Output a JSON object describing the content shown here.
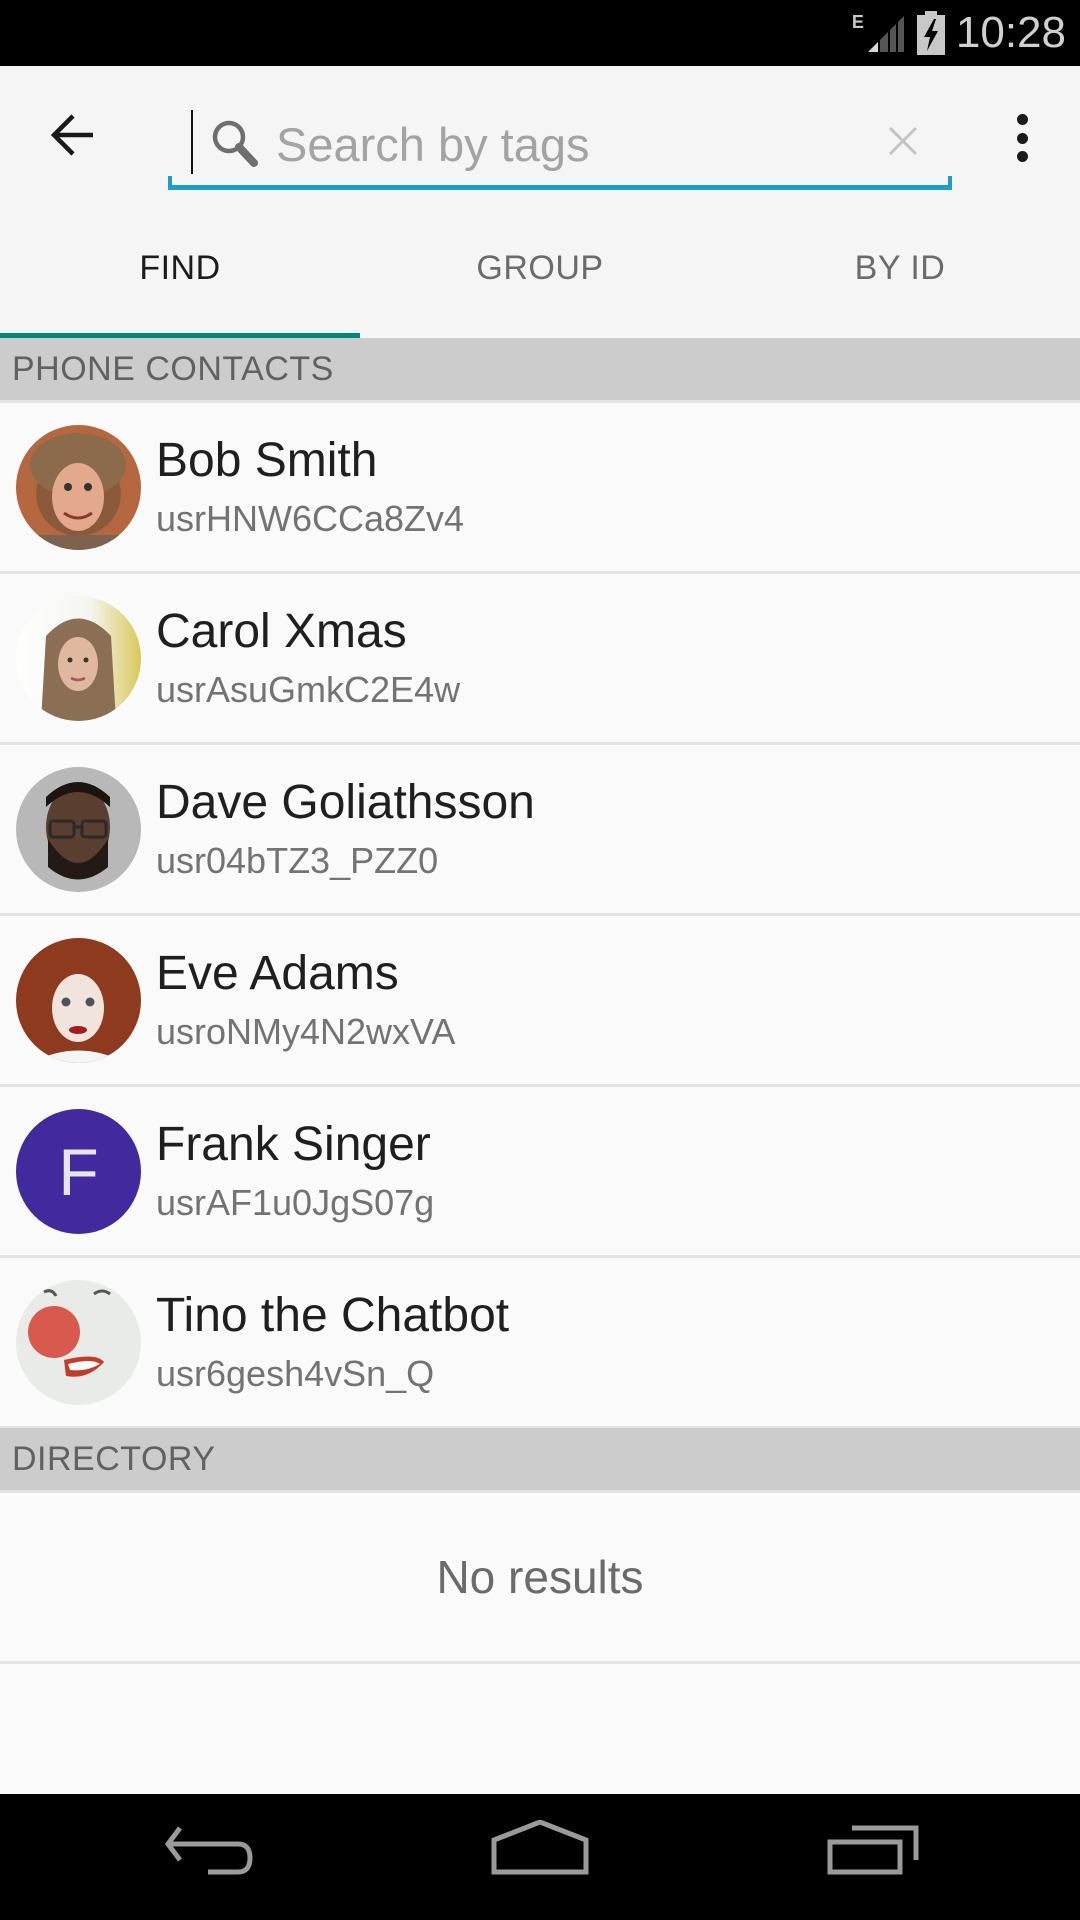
{
  "status_bar": {
    "network_type": "E",
    "time": "10:28",
    "icons": [
      "signal-icon",
      "battery-charging-icon"
    ]
  },
  "app_bar": {
    "back_icon": "arrow-left-icon",
    "search": {
      "value": "",
      "placeholder": "Search by tags",
      "icon": "search-icon",
      "clear_icon": "close-icon"
    },
    "menu_icon": "more-vert-icon",
    "accent_color": "#1a9fc9"
  },
  "tabs": [
    {
      "label": "FIND",
      "active": true
    },
    {
      "label": "GROUP",
      "active": false
    },
    {
      "label": "BY ID",
      "active": false
    }
  ],
  "tab_indicator_color": "#00877a",
  "sections": {
    "phone_contacts": {
      "title": "PHONE CONTACTS",
      "contacts": [
        {
          "name": "Bob Smith",
          "id": "usrHNW6CCa8Zv4",
          "avatar": "photo"
        },
        {
          "name": "Carol Xmas",
          "id": "usrAsuGmkC2E4w",
          "avatar": "photo"
        },
        {
          "name": "Dave Goliathsson",
          "id": "usr04bTZ3_PZZ0",
          "avatar": "photo"
        },
        {
          "name": "Eve Adams",
          "id": "usroNMy4N2wxVA",
          "avatar": "photo"
        },
        {
          "name": "Frank Singer",
          "id": "usrAF1u0JgS07g",
          "avatar": "letter",
          "letter": "F",
          "avatar_color": "#43299e"
        },
        {
          "name": "Tino the Chatbot",
          "id": "usr6gesh4vSn_Q",
          "avatar": "photo"
        }
      ]
    },
    "directory": {
      "title": "DIRECTORY",
      "empty_text": "No results"
    }
  },
  "nav_bar": {
    "buttons": [
      "back-icon",
      "home-icon",
      "recent-apps-icon"
    ]
  }
}
